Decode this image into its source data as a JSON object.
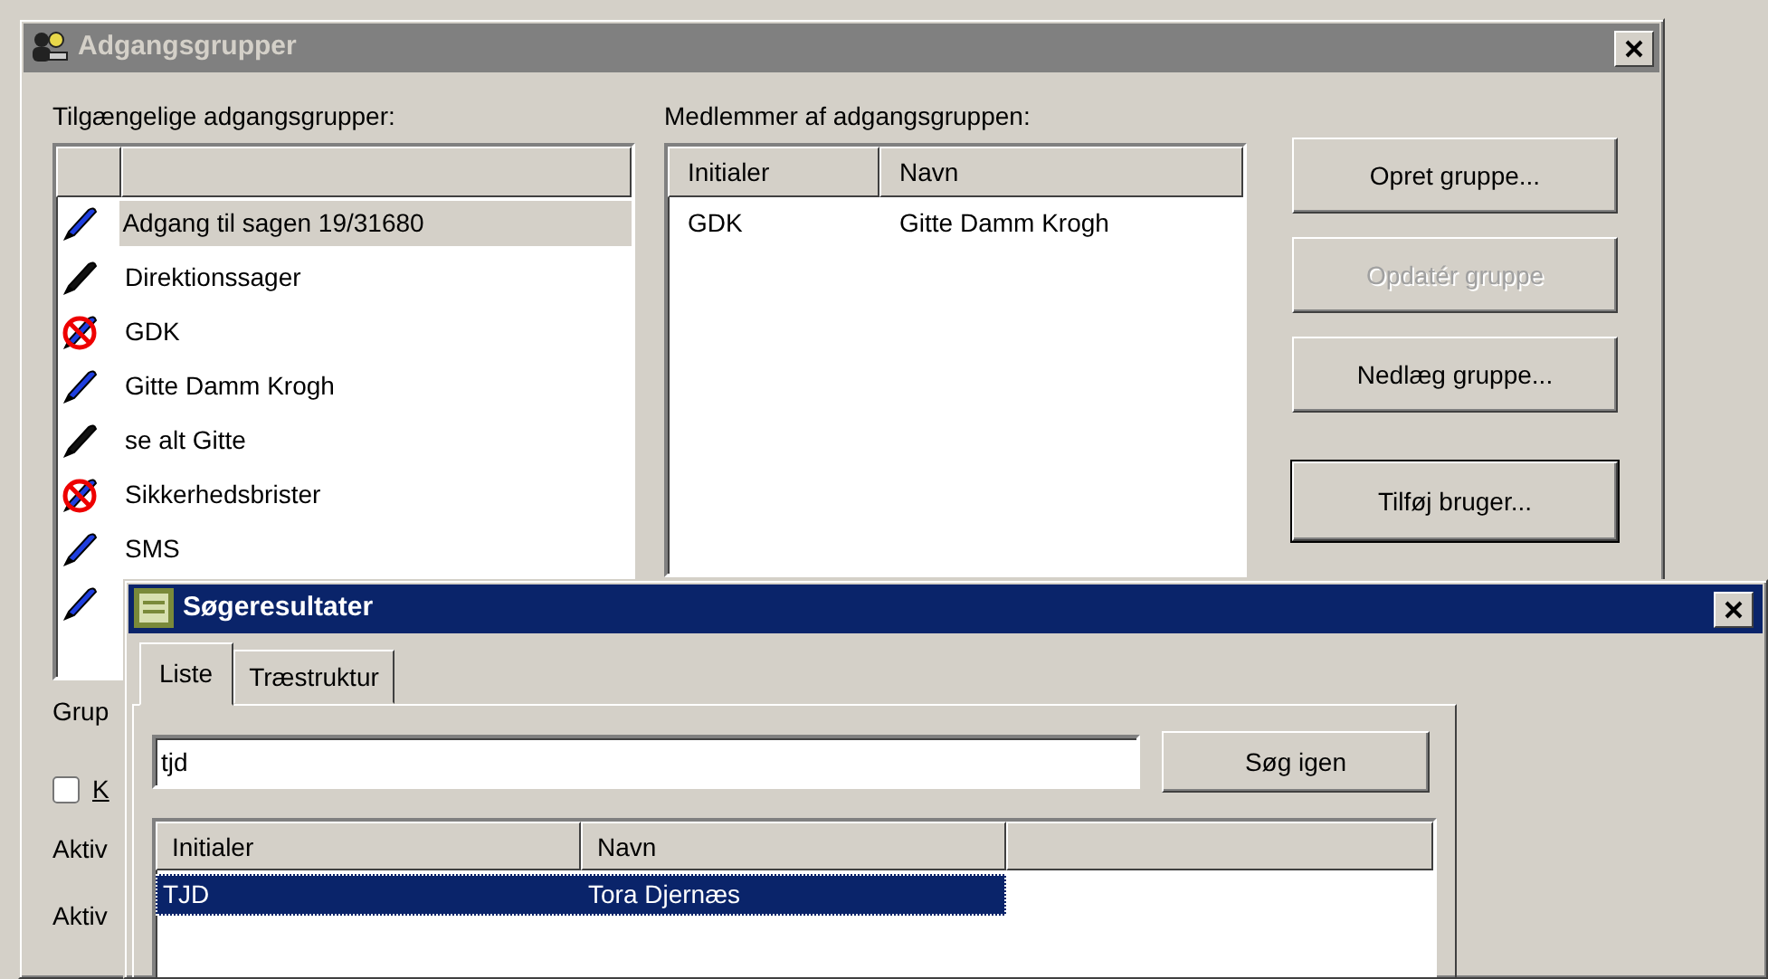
{
  "dialog": {
    "title": "Adgangsgrupper",
    "groups_label": "Tilgængelige adgangsgrupper:",
    "groups": [
      {
        "name": "Adgang til sagen 19/31680",
        "kind": "blue-pen",
        "selected": true
      },
      {
        "name": "Direktionssager",
        "kind": "black-pen",
        "selected": false
      },
      {
        "name": "GDK",
        "kind": "blocked",
        "selected": false
      },
      {
        "name": "Gitte Damm Krogh",
        "kind": "blue-pen",
        "selected": false
      },
      {
        "name": "se alt Gitte",
        "kind": "black-pen",
        "selected": false
      },
      {
        "name": "Sikkerhedsbrister",
        "kind": "blocked",
        "selected": false
      },
      {
        "name": "SMS",
        "kind": "blue-pen",
        "selected": false
      },
      {
        "kind": "blue-pen",
        "selected": false
      }
    ],
    "members_label": "Medlemmer af adgangsgruppen:",
    "members_columns": [
      "Initialer",
      "Navn"
    ],
    "members": [
      {
        "initials": "GDK",
        "name": "Gitte Damm Krogh"
      }
    ],
    "buttons": [
      {
        "label": "Opret gruppe...",
        "disabled": false,
        "default": false
      },
      {
        "label": "Opdatér gruppe",
        "disabled": true,
        "default": false
      },
      {
        "label": "Nedlæg gruppe...",
        "disabled": false,
        "default": false
      },
      {
        "label": "Tilføj bruger...",
        "disabled": false,
        "default": true
      }
    ],
    "group_label": "Grup",
    "checkbox": {
      "label": "K",
      "checked": false
    },
    "active_labels": [
      "Aktiv",
      "Aktiv"
    ]
  },
  "search_window": {
    "title": "Søgeresultater",
    "tabs": [
      {
        "label": "Liste",
        "selected": true
      },
      {
        "label": "Træstruktur",
        "selected": false
      }
    ],
    "query": "tjd",
    "search_button": "Søg igen",
    "columns": [
      "Initialer",
      "Navn"
    ],
    "results": [
      {
        "initials": "TJD",
        "name": "Tora Djernæs",
        "selected": true
      }
    ]
  }
}
